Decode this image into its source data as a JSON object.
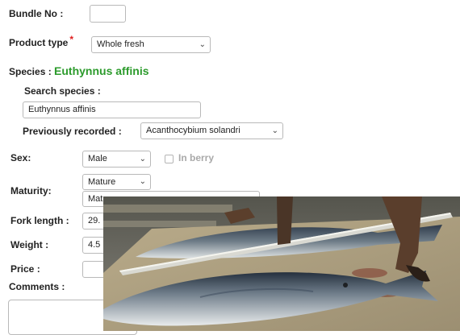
{
  "bundle": {
    "label": "Bundle No :",
    "value": ""
  },
  "product_type": {
    "label": "Product type",
    "required_mark": "*",
    "value": "Whole fresh"
  },
  "species": {
    "label": "Species :",
    "value": "Euthynnus affinis"
  },
  "search_species": {
    "label": "Search species :",
    "value": "Euthynnus affinis"
  },
  "previously_recorded": {
    "label": "Previously recorded :",
    "value": "Acanthocybium solandri"
  },
  "sex": {
    "label": "Sex:",
    "value": "Male",
    "in_berry_label": "In berry"
  },
  "maturity": {
    "label": "Maturity:",
    "value": "Mature",
    "second_value": "Mat"
  },
  "fork_length": {
    "label": "Fork length :",
    "value": "29."
  },
  "weight": {
    "label": "Weight :",
    "value": "4.5"
  },
  "price": {
    "label": "Price :",
    "value": ""
  },
  "comments": {
    "label": "Comments :",
    "value": ""
  },
  "icons": {
    "dropdown": "chevron-down-icon",
    "photo": "fish-photo"
  },
  "colors": {
    "species_green": "#2c9b2c",
    "required_red": "#e02020"
  }
}
